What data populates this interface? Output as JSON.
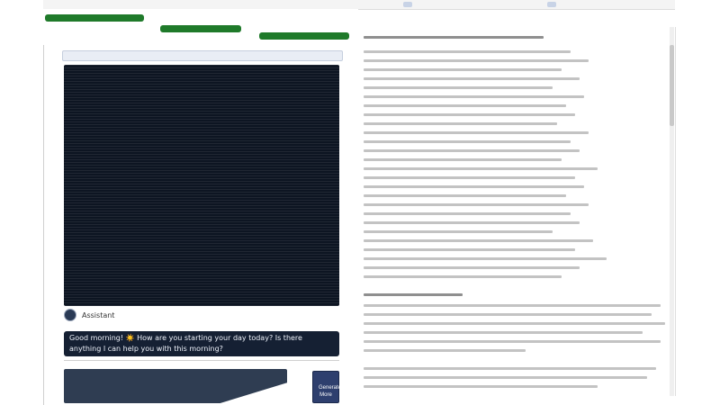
{
  "assistant": {
    "name": "Assistant"
  },
  "chat": {
    "greeting_text": "Good morning! ☀️ How are you starting your day today? Is there anything I can help you with this morning?",
    "compose_placeholder": ""
  },
  "buttons": {
    "generate_more": "Generate More"
  },
  "colors": {
    "tab_green": "#1f7a2a",
    "chat_background": "#0d1522",
    "button_navy": "#2e3f6e"
  }
}
